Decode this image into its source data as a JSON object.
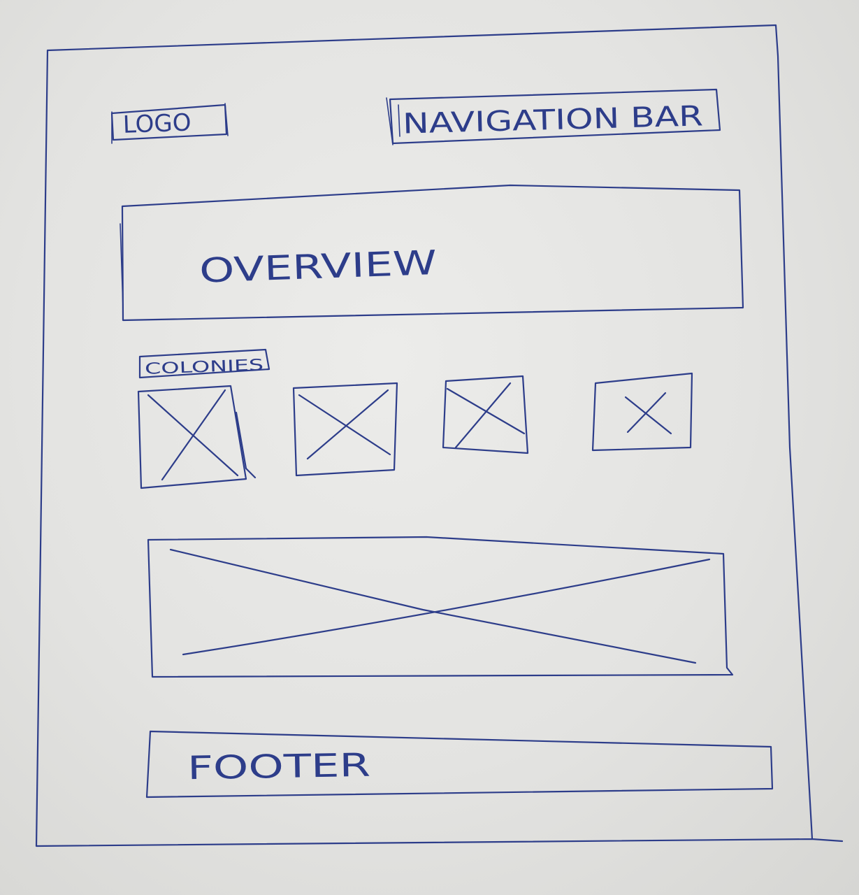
{
  "header": {
    "logo_label": "LOGO",
    "nav_label": "NAVIGATION BAR"
  },
  "overview": {
    "label": "OVERVIEW"
  },
  "colonies": {
    "label": "COLONIES",
    "count": 4
  },
  "footer": {
    "label": "FOOTER"
  },
  "colors": {
    "ink": "#2d3d8a",
    "paper": "#e6e6e4"
  }
}
